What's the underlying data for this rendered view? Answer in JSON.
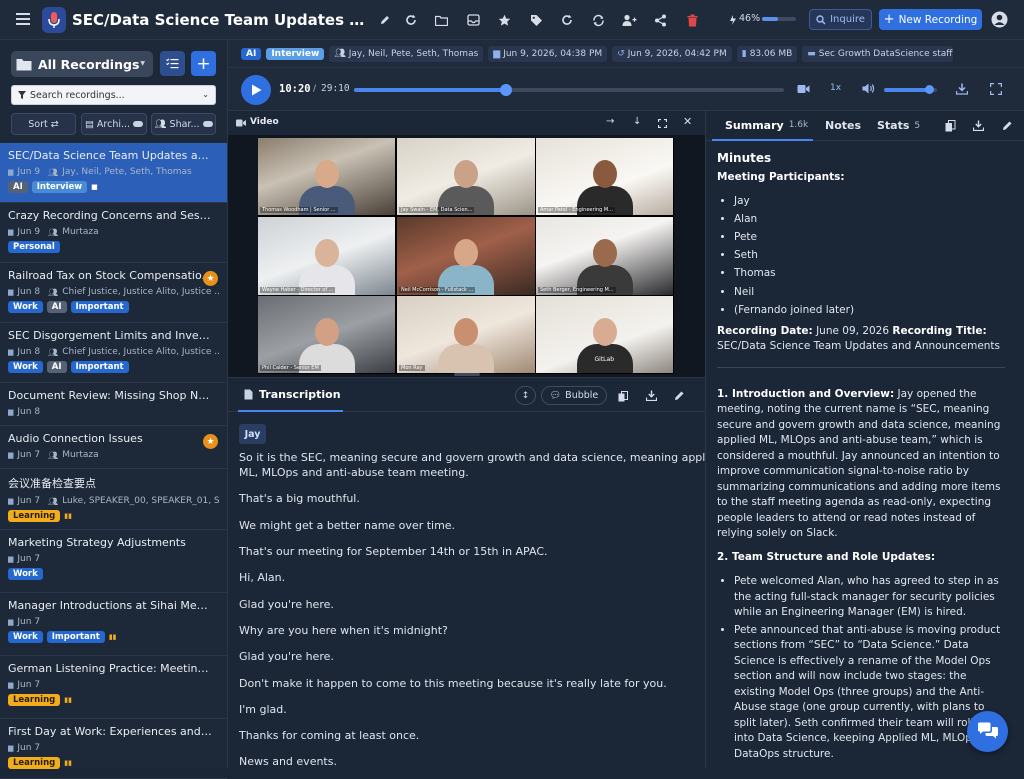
{
  "app": {
    "title": "SEC/Data Science Team Updates and A...",
    "battery": "46%",
    "inquire_label": "Inquire",
    "new_recording_label": "New Recording"
  },
  "sidebar": {
    "all_recordings_label": "All Recordings",
    "search_placeholder": "Search recordings...",
    "sort_label": "Sort",
    "archive_label": "Archi...",
    "shared_label": "Shar...",
    "recordings": [
      {
        "title": "SEC/Data Science Team Updates and A...",
        "date": "Jun 9",
        "people": "Jay, Neil, Pete, Seth, Thomas",
        "tags": [
          "AI",
          "Interview"
        ],
        "active": true
      },
      {
        "title": "Crazy Recording Concerns and Session...",
        "date": "Jun 9",
        "people": "Murtaza",
        "tags": [
          "Personal"
        ]
      },
      {
        "title": "Railroad Tax on Stock Compensatio...",
        "date": "Jun 8",
        "people": "Chief Justice, Justice Alito, Justice ...",
        "tags": [
          "Work",
          "AI",
          "Important"
        ],
        "starred": true
      },
      {
        "title": "SEC Disgorgement Limits and Investor...",
        "date": "Jun 8",
        "people": "Chief Justice, Justice Alito, Justice ...",
        "tags": [
          "Work",
          "AI",
          "Important"
        ]
      },
      {
        "title": "Document Review: Missing Shop Numb...",
        "date": "Jun 8",
        "people": "",
        "tags": []
      },
      {
        "title": "Audio Connection Issues",
        "date": "Jun 7",
        "people": "Murtaza",
        "tags": [],
        "starred": true
      },
      {
        "title": "会议准备检查要点",
        "date": "Jun 7",
        "people": "Luke, SPEAKER_00, SPEAKER_01, S...",
        "tags": [
          "Learning"
        ]
      },
      {
        "title": "Marketing Strategy Adjustments",
        "date": "Jun 7",
        "people": "",
        "tags": [
          "Work"
        ]
      },
      {
        "title": "Manager Introductions at Sihai Meeting",
        "date": "Jun 7",
        "people": "",
        "tags": [
          "Work",
          "Important"
        ]
      },
      {
        "title": "German Listening Practice: Meeting Ne...",
        "date": "Jun 7",
        "people": "",
        "tags": [
          "Learning"
        ]
      },
      {
        "title": "First Day at Work: Experiences and Ch...",
        "date": "Jun 7",
        "people": "",
        "tags": [
          "Learning"
        ]
      }
    ]
  },
  "meta": {
    "ai_tag": "AI",
    "interview_tag": "Interview",
    "participants": "Jay, Neil, Pete, Seth, Thomas",
    "created": "Jun 9, 2026, 04:38 PM",
    "updated": "Jun 9, 2026, 04:42 PM",
    "size": "83.06 MB",
    "folder": "Sec Growth DataScience staff m..."
  },
  "player": {
    "current_time": "10:20",
    "separator": "/",
    "duration": "29:10",
    "progress": 0.354,
    "speed": "1x",
    "volume": 0.85
  },
  "video": {
    "label": "Video",
    "tiles": [
      {
        "name": "Thomas Woodham | Senior ..."
      },
      {
        "name": "Jay Swain - EM, Data Scien..."
      },
      {
        "name": "Amar Patel - Engineering M..."
      },
      {
        "name": "Wayne Haber - Director of ..."
      },
      {
        "name": "Neil McCorrison - Fullstack ..."
      },
      {
        "name": "Seth Berger, Engineering M..."
      },
      {
        "name": "Phil Calder - Senior EM"
      },
      {
        "name": "Mon Ray"
      },
      {
        "name": ""
      }
    ],
    "gitlab_text": "GitLab"
  },
  "transcript": {
    "tab_label": "Transcription",
    "bubble_label": "Bubble",
    "speaker": "Jay",
    "lines": [
      "So it is the SEC, meaning secure and govern growth and data science, meaning applied",
      "ML, MLOps and anti-abuse team meeting.",
      "That's a big mouthful.",
      "We might get a better name over time.",
      "That's our meeting for September 14th or 15th in APAC.",
      "Hi, Alan.",
      "Glad you're here.",
      "Why are you here when it's midnight?",
      "Glad you're here.",
      "Don't make it happen to come to this meeting because it's really late for you.",
      "I'm glad.",
      "Thanks for coming at least once.",
      "News and events."
    ]
  },
  "summary": {
    "tab_summary": "Summary",
    "summary_count": "1.6k",
    "tab_notes": "Notes",
    "tab_stats": "Stats",
    "stats_count": "5",
    "heading": "Minutes",
    "participants_label": "Meeting Participants:",
    "participants": [
      "Jay",
      "Alan",
      "Pete",
      "Seth",
      "Thomas",
      "Neil",
      "(Fernando joined later)"
    ],
    "rec_date_label": "Recording Date:",
    "rec_date": "June 09, 2026",
    "rec_title_label": "Recording Title:",
    "rec_title": "SEC/Data Science Team Updates and Announcements",
    "section1_title": "1. Introduction and Overview:",
    "section1_text": "Jay opened the meeting, noting the current name is “SEC, meaning secure and govern growth and data science, meaning applied ML, MLOps and anti-abuse team,” which is considered a mouthful. Jay announced an intention to improve communication signal-to-noise ratio by summarizing communications and adding more items to the staff meeting agenda as read-only, expecting people leaders to attend or read notes instead of relying solely on Slack.",
    "section2_title": "2. Team Structure and Role Updates:",
    "bullets": [
      "Pete welcomed Alan, who has agreed to step in as the acting full-stack manager for security policies while an Engineering Manager (EM) is hired.",
      "Pete announced that anti-abuse is moving product sections from “SEC” to “Data Science.” Data Science is effectively a rename of the Model Ops section and will now include two stages: the existing Model Ops (three groups) and the Anti-Abuse stage (one group currently, with plans to split later). Seth confirmed their team will roll up into Data Science, keeping Applied ML, MLOps, and DataOps structure."
    ]
  },
  "colors": {
    "accent": "#2f6fe0",
    "active_row": "#2c5fb8",
    "tag_blue": "#2569d0",
    "tag_orange": "#f0ad1e",
    "star": "#e8901a",
    "danger": "#e04848"
  }
}
